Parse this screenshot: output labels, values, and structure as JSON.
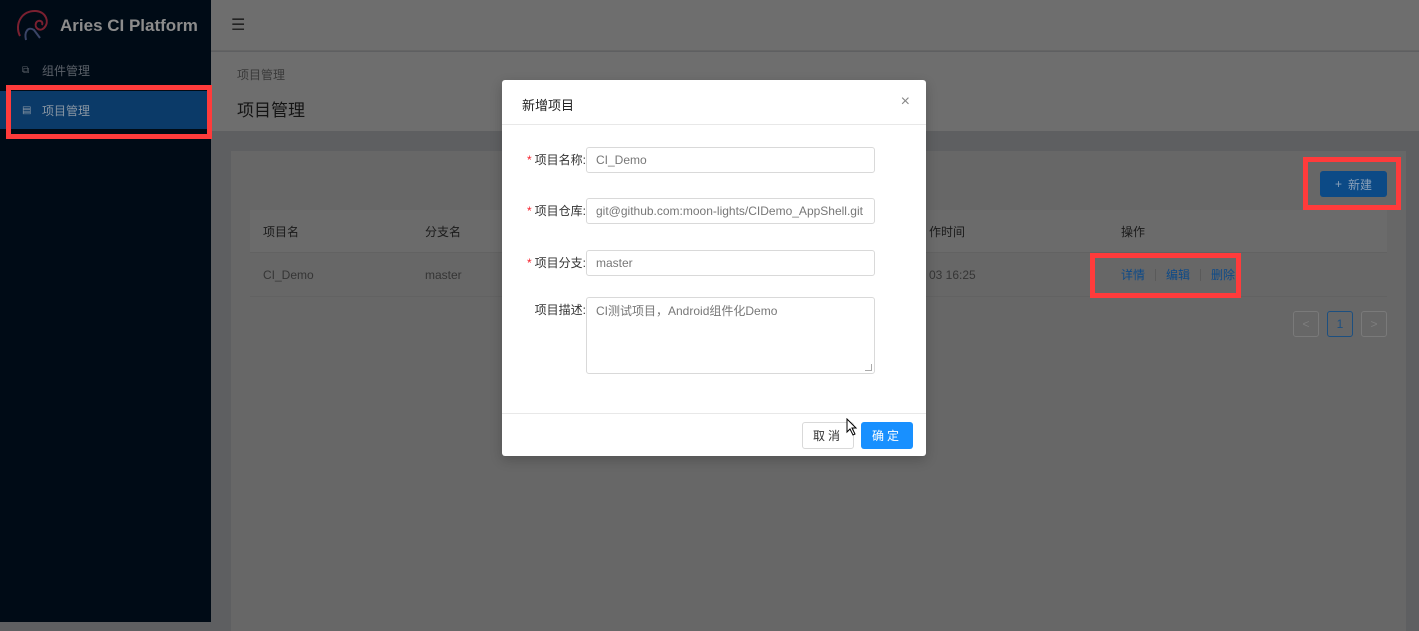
{
  "app": {
    "title": "Aries CI Platform"
  },
  "sidebar": {
    "items": [
      {
        "label": "组件管理",
        "icon": "component-icon"
      },
      {
        "label": "项目管理",
        "icon": "project-icon",
        "active": true
      }
    ]
  },
  "header": {
    "fold_icon": "menu-fold-icon"
  },
  "page": {
    "breadcrumb": "项目管理",
    "title": "项目管理"
  },
  "toolbar": {
    "new_label": "新建"
  },
  "table": {
    "headers": [
      "项目名",
      "分支名",
      "作时间",
      "操作"
    ],
    "rows": [
      {
        "name": "CI_Demo",
        "branch": "master",
        "time": "03 16:25",
        "actions": [
          "详情",
          "编辑",
          "删除"
        ]
      }
    ]
  },
  "pagination": {
    "prev": "<",
    "current": "1",
    "next": ">"
  },
  "modal": {
    "title": "新增项目",
    "fields": [
      {
        "label": "项目名称:",
        "required": true,
        "value": "CI_Demo"
      },
      {
        "label": "项目仓库:",
        "required": true,
        "value": "git@github.com:moon-lights/CIDemo_AppShell.git"
      },
      {
        "label": "项目分支:",
        "required": true,
        "value": "master"
      },
      {
        "label": "项目描述:",
        "required": false,
        "value": "CI测试项目，Android组件化Demo"
      }
    ],
    "cancel_label": "取消",
    "ok_label": "确定",
    "required_mark": "*",
    "close_symbol": "×"
  },
  "colors": {
    "primary": "#1890ff",
    "sidebar": "#001529",
    "highlight": "#ff3b3b"
  }
}
